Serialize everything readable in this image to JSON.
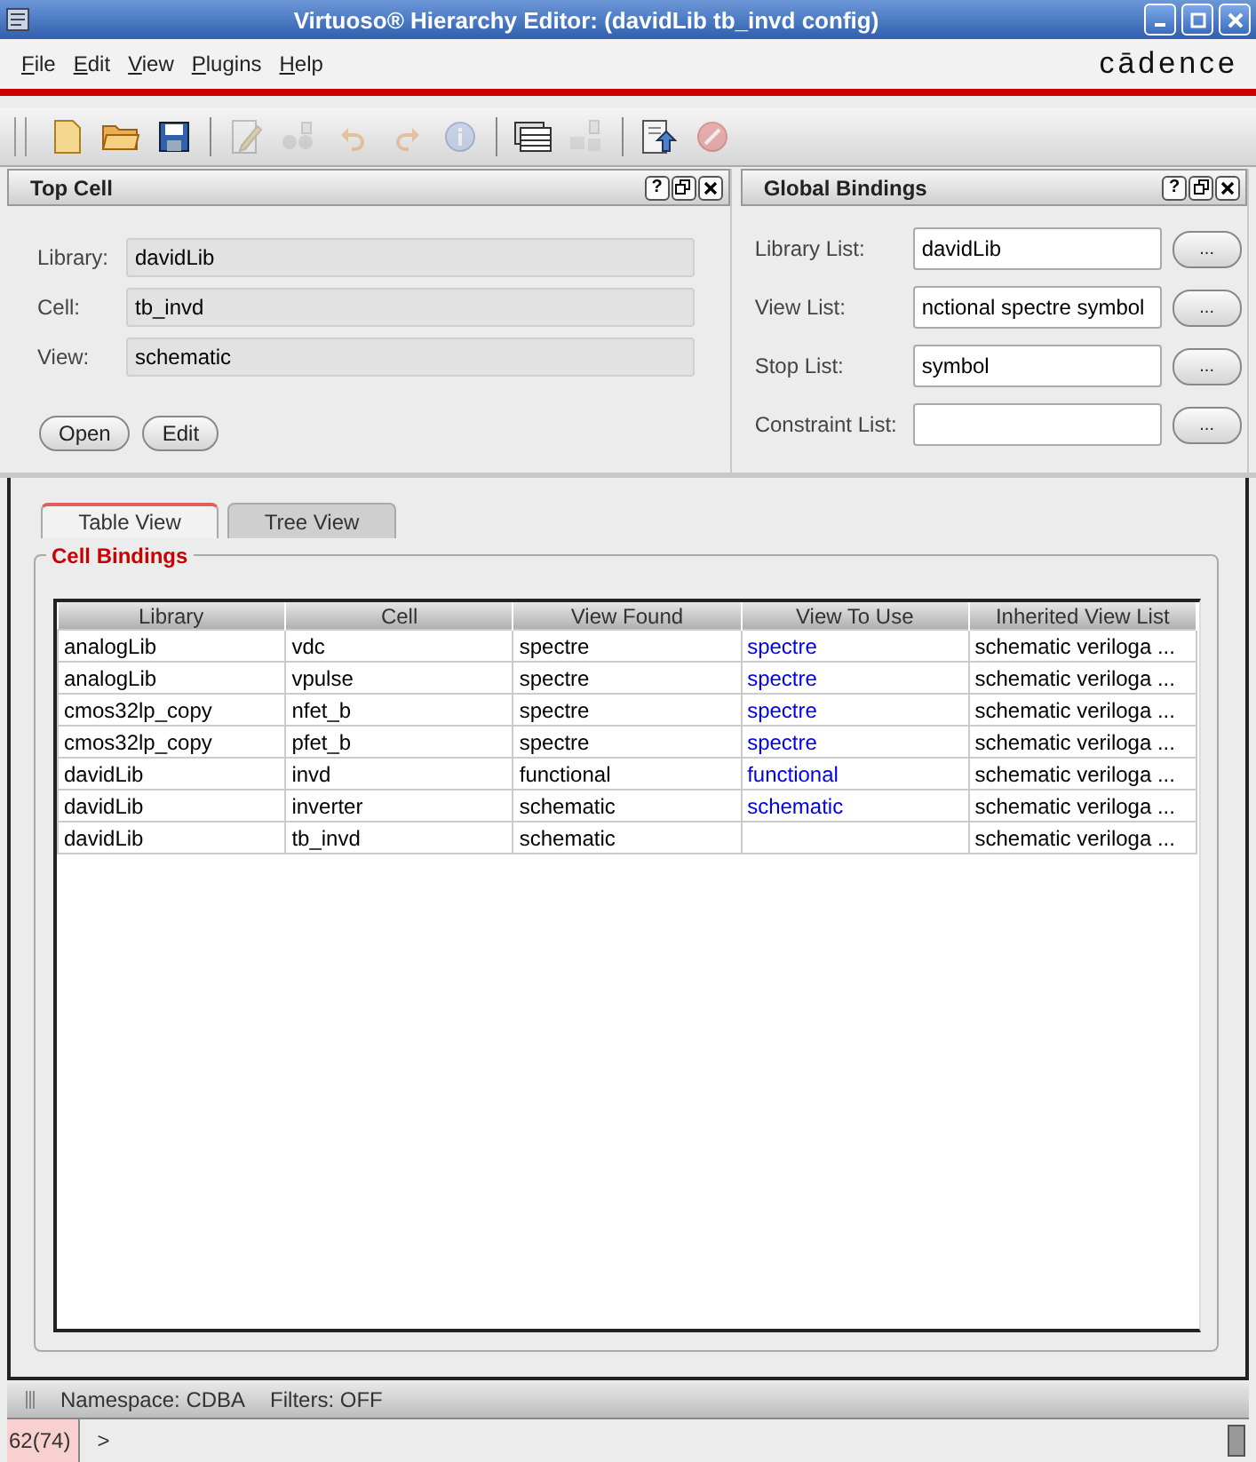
{
  "window": {
    "title": "Virtuoso® Hierarchy Editor: (davidLib tb_invd config)"
  },
  "menu": [
    "File",
    "Edit",
    "View",
    "Plugins",
    "Help"
  ],
  "logo": "cādence",
  "toolbar": [
    {
      "kind": "new",
      "disabled": false
    },
    {
      "kind": "open",
      "disabled": false
    },
    {
      "kind": "save",
      "disabled": false
    },
    {
      "kind": "sep"
    },
    {
      "kind": "edit",
      "disabled": true
    },
    {
      "kind": "hier",
      "disabled": true
    },
    {
      "kind": "undo",
      "disabled": true
    },
    {
      "kind": "redo",
      "disabled": true
    },
    {
      "kind": "info",
      "disabled": true
    },
    {
      "kind": "sep"
    },
    {
      "kind": "table",
      "disabled": false
    },
    {
      "kind": "tree",
      "disabled": true
    },
    {
      "kind": "sep"
    },
    {
      "kind": "export",
      "disabled": false
    },
    {
      "kind": "stop",
      "disabled": true
    }
  ],
  "top_cell": {
    "title": "Top Cell",
    "help": "?",
    "fields": [
      {
        "label": "Library:",
        "value": "davidLib"
      },
      {
        "label": "Cell:",
        "value": "tb_invd"
      },
      {
        "label": "View:",
        "value": "schematic"
      }
    ],
    "buttons": [
      "Open",
      "Edit"
    ]
  },
  "global_bindings": {
    "title": "Global Bindings",
    "help": "?",
    "browse": "...",
    "fields": [
      {
        "label": "Library List:",
        "value": "davidLib"
      },
      {
        "label": "View List:",
        "value": "nctional spectre symbol"
      },
      {
        "label": "Stop List:",
        "value": "symbol"
      },
      {
        "label": "Constraint List:"
      }
    ]
  },
  "tabs": [
    {
      "label": "Table View",
      "selected": true
    },
    {
      "label": "Tree View",
      "selected": false
    }
  ],
  "cell_bindings": {
    "title": "Cell Bindings",
    "columns": [
      "Library",
      "Cell",
      "View Found",
      "View To Use",
      "Inherited View List"
    ],
    "rows": [
      {
        "library": "analogLib",
        "cell": "vdc",
        "view_found": "spectre",
        "view_to_use": "spectre",
        "inherited": "schematic veriloga ..."
      },
      {
        "library": "analogLib",
        "cell": "vpulse",
        "view_found": "spectre",
        "view_to_use": "spectre",
        "inherited": "schematic veriloga ..."
      },
      {
        "library": "cmos32lp_copy",
        "cell": "nfet_b",
        "view_found": "spectre",
        "view_to_use": "spectre",
        "inherited": "schematic veriloga ..."
      },
      {
        "library": "cmos32lp_copy",
        "cell": "pfet_b",
        "view_found": "spectre",
        "view_to_use": "spectre",
        "inherited": "schematic veriloga ..."
      },
      {
        "library": "davidLib",
        "cell": "invd",
        "view_found": "functional",
        "view_to_use": "functional",
        "inherited": "schematic veriloga ..."
      },
      {
        "library": "davidLib",
        "cell": "inverter",
        "view_found": "schematic",
        "view_to_use": "schematic",
        "inherited": "schematic veriloga ..."
      },
      {
        "library": "davidLib",
        "cell": "tb_invd",
        "view_found": "schematic",
        "inherited": "schematic veriloga ..."
      }
    ]
  },
  "status_bar": {
    "namespace": "Namespace: CDBA",
    "filters": "Filters: OFF"
  },
  "command_line": {
    "count": "62(74)",
    "prompt": ">"
  }
}
